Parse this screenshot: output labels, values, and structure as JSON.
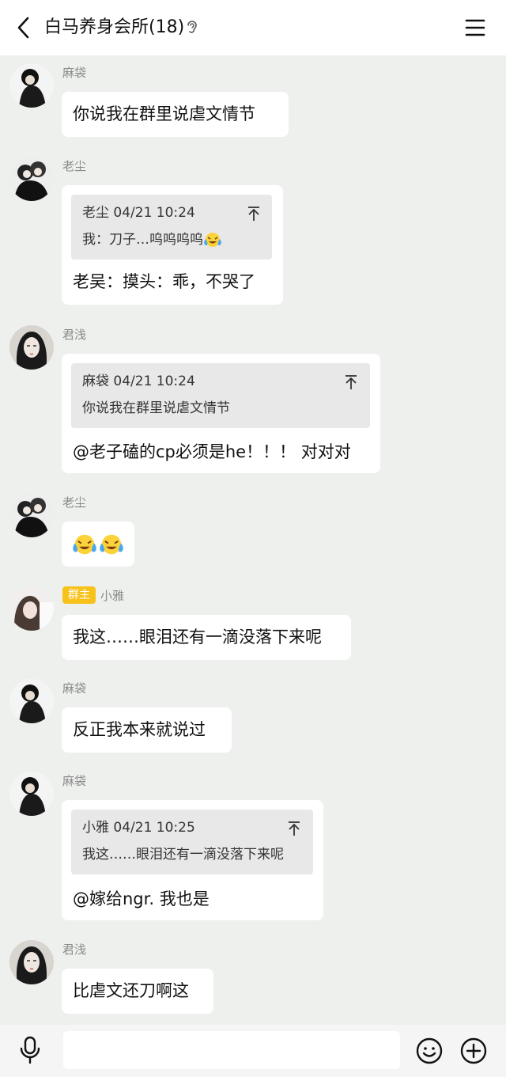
{
  "header": {
    "title": "白马养身会所(18)"
  },
  "messages": [
    {
      "sender": "麻袋",
      "text": "你说我在群里说虐文情节"
    },
    {
      "sender": "老尘",
      "quote_head": "老尘 04/21 10:24",
      "quote_text": "我：刀子…呜呜呜呜",
      "text": "老吴：摸头：乖，不哭了"
    },
    {
      "sender": "君浅",
      "quote_head": "麻袋 04/21 10:24",
      "quote_text": "你说我在群里说虐文情节",
      "text": "@老子磕的cp必须是he！！！ 对对对"
    },
    {
      "sender": "老尘",
      "text": ""
    },
    {
      "badge": "群主",
      "sender": "小雅",
      "text": "我这……眼泪还有一滴没落下来呢"
    },
    {
      "sender": "麻袋",
      "text": "反正我本来就说过"
    },
    {
      "sender": "麻袋",
      "quote_head": "小雅 04/21 10:25",
      "quote_text": "我这……眼泪还有一滴没落下来呢",
      "text": "@嫁给ngr. 我也是"
    },
    {
      "sender": "君浅",
      "text": "比虐文还刀啊这"
    }
  ],
  "icons": {
    "back": "chevron-left-icon",
    "ear": "ear-icon",
    "menu": "menu-icon",
    "quote_jump": "jump-to-top-icon",
    "crying_emoji": "crying-laughing-emoji-icon",
    "mic": "microphone-icon",
    "emoji": "smiley-icon",
    "plus": "plus-circle-icon"
  },
  "colors": {
    "background": "#edf0ed",
    "bubble": "#ffffff",
    "quote": "#e8e8e8",
    "badge": "#f7c21c"
  }
}
